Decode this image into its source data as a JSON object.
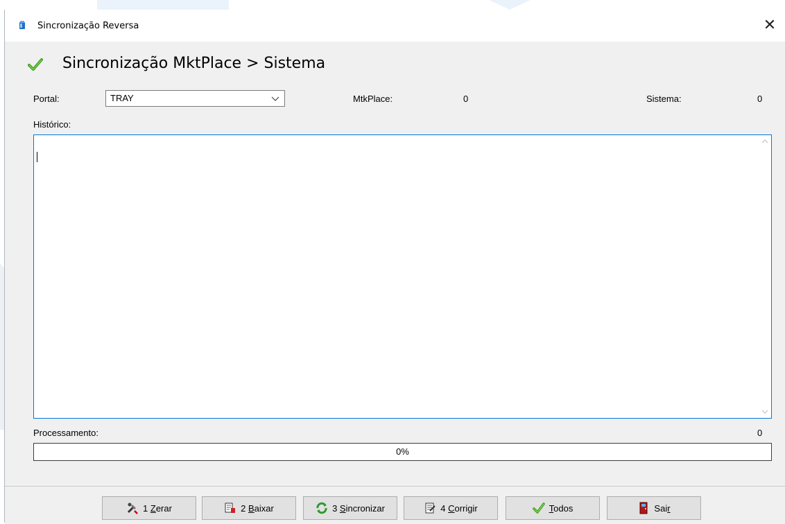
{
  "window": {
    "title": "Sincronização Reversa",
    "close_glyph": "✕"
  },
  "header": {
    "title": "Sincronização MktPlace > Sistema",
    "icon": "check-icon"
  },
  "form": {
    "portal_label": "Portal:",
    "portal_value": "TRAY",
    "mtkplace_label": "MtkPlace:",
    "mtkplace_value": "0",
    "sistema_label": "Sistema:",
    "sistema_value": "0",
    "historico_label": "Histórico:",
    "historico_value": ""
  },
  "processing": {
    "label": "Processamento:",
    "count": "0",
    "progress_text": "0%",
    "progress_fraction": 0
  },
  "buttons": [
    {
      "prefix": "1 ",
      "mnemonic": "Z",
      "rest": "erar",
      "icon": "tools-icon"
    },
    {
      "prefix": "2 ",
      "mnemonic": "B",
      "rest": "aixar",
      "icon": "download-doc-icon"
    },
    {
      "prefix": "3 ",
      "mnemonic": "S",
      "rest": "incronizar",
      "icon": "sync-icon"
    },
    {
      "prefix": "4 ",
      "mnemonic": "C",
      "rest": "orrigir",
      "icon": "fix-doc-icon"
    },
    {
      "prefix": "",
      "mnemonic": "T",
      "rest": "odos",
      "icon": "check-icon"
    },
    {
      "prefix": "Sai",
      "mnemonic": "r",
      "rest": "",
      "icon": "exit-door-icon"
    }
  ],
  "colors": {
    "focus_border": "#0078d7",
    "check_green": "#3a9a1a",
    "progress_green": "#06b025"
  }
}
